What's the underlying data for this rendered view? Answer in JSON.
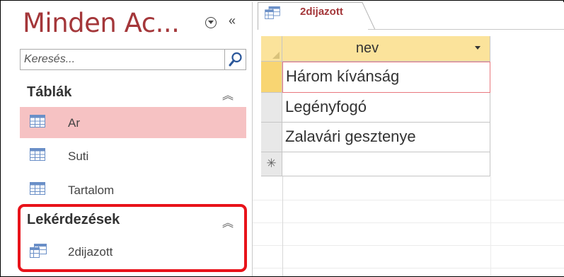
{
  "nav_pane": {
    "title": "Minden Ac...",
    "search": {
      "placeholder": "Keresés...",
      "value": ""
    },
    "groups": [
      {
        "label": "Táblák",
        "items": [
          {
            "label": "Ar",
            "icon": "table-icon",
            "selected": true
          },
          {
            "label": "Suti",
            "icon": "table-icon",
            "selected": false
          },
          {
            "label": "Tartalom",
            "icon": "table-icon",
            "selected": false
          }
        ]
      },
      {
        "label": "Lekérdezések",
        "items": [
          {
            "label": "2dijazott",
            "icon": "query-icon",
            "selected": false
          }
        ]
      }
    ]
  },
  "document_tab": {
    "label": "2dijazott",
    "icon": "query-icon"
  },
  "datasheet": {
    "columns": [
      "nev"
    ],
    "rows": [
      [
        "Három kívánság"
      ],
      [
        "Legényfogó"
      ],
      [
        "Zalavári gesztenye"
      ]
    ],
    "new_row_marker": "✳"
  },
  "colors": {
    "title": "#a4373a",
    "selected_item": "#f6c2c3",
    "header": "#fbe39b",
    "current_row": "#f8d572",
    "annotation_box": "#e8131a"
  }
}
